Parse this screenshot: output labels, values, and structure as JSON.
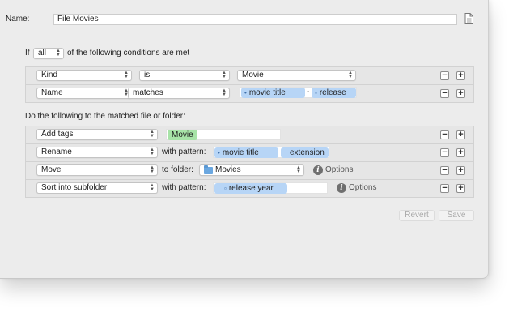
{
  "header": {
    "name_label": "Name:",
    "name_value": "File Movies",
    "doc_icon": "document-icon"
  },
  "conditions": {
    "prefix": "If",
    "match_mode": "all",
    "suffix": "of the following conditions are met",
    "rows": [
      {
        "attribute": "Kind",
        "operator": "is",
        "value": "Movie"
      },
      {
        "attribute": "Name",
        "operator": "matches",
        "tokens": [
          "movie title",
          "release"
        ],
        "joiner": "-"
      }
    ]
  },
  "actions": {
    "heading": "Do the following to the matched file or folder:",
    "rows": [
      {
        "action": "Add tags",
        "tag": "Movie"
      },
      {
        "action": "Rename",
        "label": "with pattern:",
        "tokens": [
          "movie title",
          "extension"
        ]
      },
      {
        "action": "Move",
        "label": "to folder:",
        "folder": "Movies",
        "options_label": "Options"
      },
      {
        "action": "Sort into subfolder",
        "label": "with pattern:",
        "tokens": [
          "release year"
        ],
        "options_label": "Options"
      }
    ]
  },
  "footer": {
    "revert_label": "Revert",
    "save_label": "Save"
  }
}
